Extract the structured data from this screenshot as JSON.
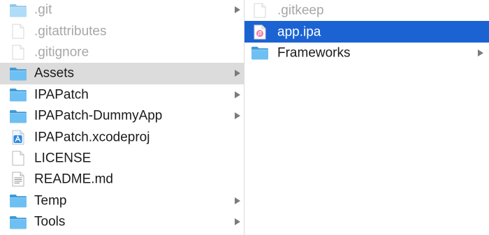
{
  "column1": {
    "items": [
      {
        "name": ".git",
        "kind": "folder",
        "hidden": true,
        "has_children": true,
        "state": "normal"
      },
      {
        "name": ".gitattributes",
        "kind": "file",
        "hidden": true,
        "has_children": false,
        "state": "normal"
      },
      {
        "name": ".gitignore",
        "kind": "file",
        "hidden": true,
        "has_children": false,
        "state": "normal"
      },
      {
        "name": "Assets",
        "kind": "folder",
        "hidden": false,
        "has_children": true,
        "state": "active-path"
      },
      {
        "name": "IPAPatch",
        "kind": "folder",
        "hidden": false,
        "has_children": true,
        "state": "normal"
      },
      {
        "name": "IPAPatch-DummyApp",
        "kind": "folder",
        "hidden": false,
        "has_children": true,
        "state": "normal"
      },
      {
        "name": "IPAPatch.xcodeproj",
        "kind": "xcodeproj",
        "hidden": false,
        "has_children": false,
        "state": "normal"
      },
      {
        "name": "LICENSE",
        "kind": "file",
        "hidden": false,
        "has_children": false,
        "state": "normal"
      },
      {
        "name": "README.md",
        "kind": "text",
        "hidden": false,
        "has_children": false,
        "state": "normal"
      },
      {
        "name": "Temp",
        "kind": "folder",
        "hidden": false,
        "has_children": true,
        "state": "normal"
      },
      {
        "name": "Tools",
        "kind": "folder",
        "hidden": false,
        "has_children": true,
        "state": "normal"
      }
    ]
  },
  "column2": {
    "items": [
      {
        "name": ".gitkeep",
        "kind": "file",
        "hidden": true,
        "has_children": false,
        "state": "normal"
      },
      {
        "name": "app.ipa",
        "kind": "ipa",
        "hidden": false,
        "has_children": false,
        "state": "selected"
      },
      {
        "name": "Frameworks",
        "kind": "folder",
        "hidden": false,
        "has_children": true,
        "state": "normal"
      }
    ]
  },
  "icons": {
    "folder": "folder-icon",
    "file": "blank-document-icon",
    "xcodeproj": "xcode-project-icon",
    "text": "text-document-icon",
    "ipa": "ipa-package-icon"
  },
  "colors": {
    "selection": "#1b63d3",
    "active_path": "#dcdcdc",
    "hidden_text": "#a7a7a7",
    "text": "#1a1a1a",
    "folder": "#5fb3ea"
  }
}
